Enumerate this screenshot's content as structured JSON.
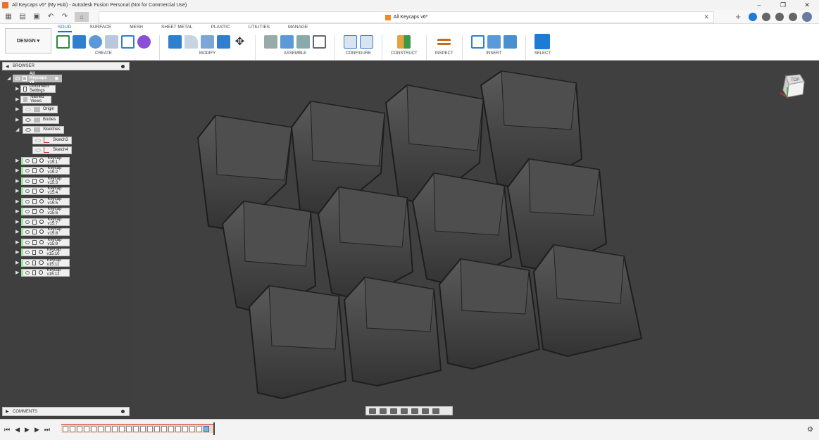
{
  "window": {
    "title": "All Keycaps v6* (My Hub) - Autodesk Fusion Personal (Not for Commercial Use)",
    "doc_tab": "All Keycaps v6*"
  },
  "ribbon": {
    "workspace": "DESIGN",
    "tabs": [
      "SOLID",
      "SURFACE",
      "MESH",
      "SHEET METAL",
      "PLASTIC",
      "UTILITIES",
      "MANAGE"
    ],
    "active_tab": "SOLID",
    "groups": {
      "create": "CREATE",
      "modify": "MODIFY",
      "assemble": "ASSEMBLE",
      "configure": "CONFIGURE",
      "construct": "CONSTRUCT",
      "inspect": "INSPECT",
      "insert": "INSERT",
      "select": "SELECT"
    }
  },
  "browser": {
    "title": "BROWSER",
    "root": "All Keycaps v6",
    "items": [
      "Document Settings",
      "Named Views",
      "Origin",
      "Bodies",
      "Sketches",
      "Sketch3",
      "Sketch4",
      "Keycap v15:1",
      "Keycap v15:2",
      "Keycap v15:3",
      "Keycap v15:4",
      "Keycap v15:5",
      "Keycap v15:6",
      "Keycap v15:7",
      "Keycap v15:8",
      "Keycap v15:9",
      "Keycap v15:10",
      "Keycap v15:11",
      "Keycap v15:12"
    ]
  },
  "comments": {
    "title": "COMMENTS"
  },
  "viewcube": {
    "face": "TOP"
  },
  "colors": {
    "accent": "#1c6fd0",
    "viewport_bg": "#404040",
    "keycap": "#4a4a4a"
  }
}
